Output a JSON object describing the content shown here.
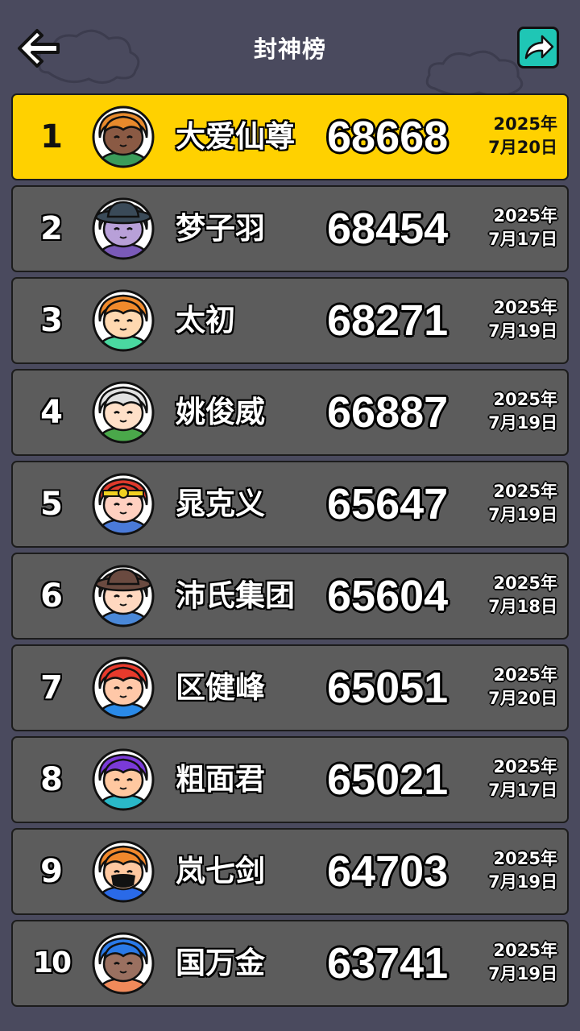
{
  "header": {
    "title": "封神榜",
    "back_icon": "arrow-left-icon",
    "share_icon": "share-arrow-icon"
  },
  "colors": {
    "background": "#4a4a5e",
    "row_default": "#5c5c5c",
    "row_top": "#ffd100",
    "share_button": "#1fc6b5"
  },
  "leaderboard": [
    {
      "rank": "1",
      "name": "大爱仙尊",
      "score": "68668",
      "date_year": "2025年",
      "date_day": "7月20日",
      "hair": "#e88a2c",
      "skin": "#8a5a44",
      "shirt": "#3a9c5a",
      "hat": "none"
    },
    {
      "rank": "2",
      "name": "梦子羽",
      "score": "68454",
      "date_year": "2025年",
      "date_day": "7月17日",
      "hair": "#3a4a58",
      "skin": "#b8a0d8",
      "shirt": "#7a5ab8",
      "hat": "wide"
    },
    {
      "rank": "3",
      "name": "太初",
      "score": "68271",
      "date_year": "2025年",
      "date_day": "7月19日",
      "hair": "#f08a2c",
      "skin": "#ffd8b0",
      "shirt": "#4ad8a0",
      "hat": "none"
    },
    {
      "rank": "4",
      "name": "姚俊威",
      "score": "66887",
      "date_year": "2025年",
      "date_day": "7月19日",
      "hair": "#e0e0e0",
      "skin": "#ffe0c8",
      "shirt": "#4aa84a",
      "hat": "none"
    },
    {
      "rank": "5",
      "name": "晁克义",
      "score": "65647",
      "date_year": "2025年",
      "date_day": "7月19日",
      "hair": "#e03a2c",
      "skin": "#ffd0c0",
      "shirt": "#4a7ad8",
      "hat": "band"
    },
    {
      "rank": "6",
      "name": "沛氏集团",
      "score": "65604",
      "date_year": "2025年",
      "date_day": "7月18日",
      "hair": "#6a4a40",
      "skin": "#ffd8c0",
      "shirt": "#4a88d8",
      "hat": "wide"
    },
    {
      "rank": "7",
      "name": "区健峰",
      "score": "65051",
      "date_year": "2025年",
      "date_day": "7月20日",
      "hair": "#e83a2c",
      "skin": "#ffc8a8",
      "shirt": "#2a8ae8",
      "hat": "none"
    },
    {
      "rank": "8",
      "name": "粗面君",
      "score": "65021",
      "date_year": "2025年",
      "date_day": "7月17日",
      "hair": "#7a3ad8",
      "skin": "#ffc8a0",
      "shirt": "#2ab8c8",
      "hat": "none"
    },
    {
      "rank": "9",
      "name": "岚七剑",
      "score": "64703",
      "date_year": "2025年",
      "date_day": "7月19日",
      "hair": "#f0882c",
      "skin": "#ffc8a0",
      "shirt": "#2a6ae8",
      "hat": "mask"
    },
    {
      "rank": "10",
      "name": "国万金",
      "score": "63741",
      "date_year": "2025年",
      "date_day": "7月19日",
      "hair": "#2a7ae8",
      "skin": "#9a7060",
      "shirt": "#f08a5a",
      "hat": "none"
    }
  ]
}
